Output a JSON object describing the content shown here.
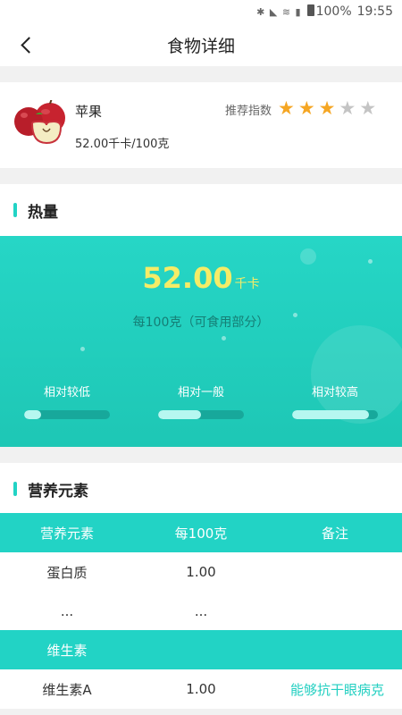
{
  "status_bar": {
    "icons": "✱ ◣ ≋ ▮",
    "battery": "100%",
    "time": "19:55"
  },
  "nav": {
    "title": "食物详细",
    "back_icon": "chevron-left-icon"
  },
  "food": {
    "name": "苹果",
    "calories": "52.00千卡/100克",
    "recommend_label": "推荐指数",
    "rating": 3,
    "rating_max": 5
  },
  "energy_section": {
    "title": "热量",
    "value": "52.00",
    "unit": "千卡",
    "per_label": "每100克（可食用部分）",
    "levels": [
      {
        "label": "相对较低",
        "fill": 0.2
      },
      {
        "label": "相对一般",
        "fill": 0.5
      },
      {
        "label": "相对较高",
        "fill": 0.9
      }
    ]
  },
  "nutrition_section": {
    "title": "营养元素",
    "headers": [
      "营养元素",
      "每100克",
      "备注"
    ],
    "rows": [
      {
        "name": "蛋白质",
        "value": "1.00",
        "note": ""
      },
      {
        "name": "...",
        "value": "...",
        "note": ""
      }
    ],
    "vitamin_group": "维生素",
    "vitamin_rows": [
      {
        "name": "维生素A",
        "value": "1.00",
        "note": "能够抗干眼病克"
      }
    ]
  },
  "colors": {
    "accent": "#22d3c5",
    "star_on": "#f5a623",
    "energy_value": "#f5ec67"
  }
}
